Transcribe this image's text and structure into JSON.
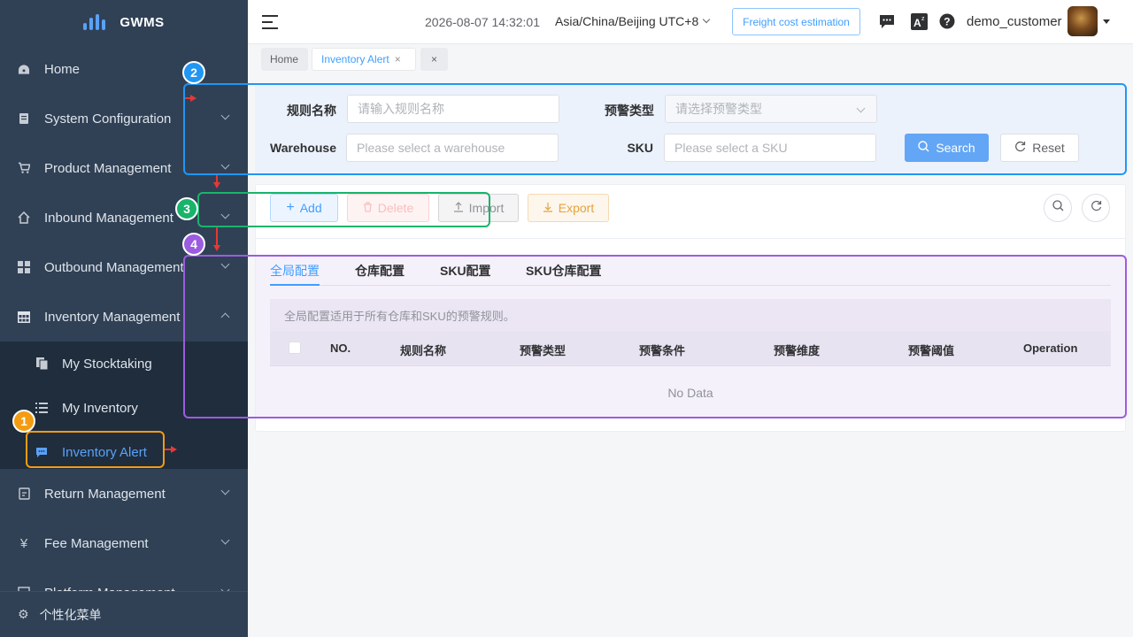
{
  "sidebar": {
    "logo_text": "GWMS",
    "items": [
      {
        "label": "Home",
        "icon": "dashboard-icon"
      },
      {
        "label": "System Configuration",
        "icon": "document-icon"
      },
      {
        "label": "Product Management",
        "icon": "cart-icon"
      },
      {
        "label": "Inbound Management",
        "icon": "house-icon"
      },
      {
        "label": "Outbound Management",
        "icon": "grid-icon"
      },
      {
        "label": "Inventory Management",
        "icon": "table-icon"
      },
      {
        "label": "Return Management",
        "icon": "return-icon"
      },
      {
        "label": "Fee Management",
        "icon": "yen-icon"
      },
      {
        "label": "Platform Management",
        "icon": "platform-icon"
      }
    ],
    "subitems": [
      {
        "label": "My Stocktaking",
        "icon": "copy-icon"
      },
      {
        "label": "My Inventory",
        "icon": "list-icon"
      },
      {
        "label": "Inventory Alert",
        "icon": "chat-icon"
      }
    ],
    "footer_label": "个性化菜单"
  },
  "header": {
    "datetime": "2026-08-07 14:32:01",
    "timezone": "Asia/China/Beijing UTC+8",
    "freight_button": "Freight cost estimation",
    "username": "demo_customer"
  },
  "tags": {
    "home": "Home",
    "current": "Inventory Alert",
    "close_all": "×",
    "close_x": "×"
  },
  "search": {
    "rule_name_label": "规则名称",
    "rule_name_placeholder": "请输入规则名称",
    "alert_type_label": "预警类型",
    "alert_type_placeholder": "请选择预警类型",
    "warehouse_label": "Warehouse",
    "warehouse_placeholder": "Please select a warehouse",
    "sku_label": "SKU",
    "sku_placeholder": "Please select a SKU",
    "search_button": "Search",
    "reset_button": "Reset"
  },
  "toolbar": {
    "add": "Add",
    "delete": "Delete",
    "import": "Import",
    "export": "Export"
  },
  "tabs": [
    "全局配置",
    "仓库配置",
    "SKU配置",
    "SKU仓库配置"
  ],
  "info_text": "全局配置适用于所有仓库和SKU的预警规则。",
  "table": {
    "columns": [
      "NO.",
      "规则名称",
      "预警类型",
      "预警条件",
      "预警维度",
      "预警阈值",
      "Operation"
    ],
    "empty_text": "No Data"
  },
  "annotations": [
    "1",
    "2",
    "3",
    "4"
  ],
  "colors": {
    "sidebar_bg": "#304156",
    "accent": "#409eff",
    "annotation_1": "#f39c12",
    "annotation_2": "#2196f3",
    "annotation_3": "#19b46b",
    "annotation_4": "#9c5ce0",
    "arrow": "#e53935"
  }
}
